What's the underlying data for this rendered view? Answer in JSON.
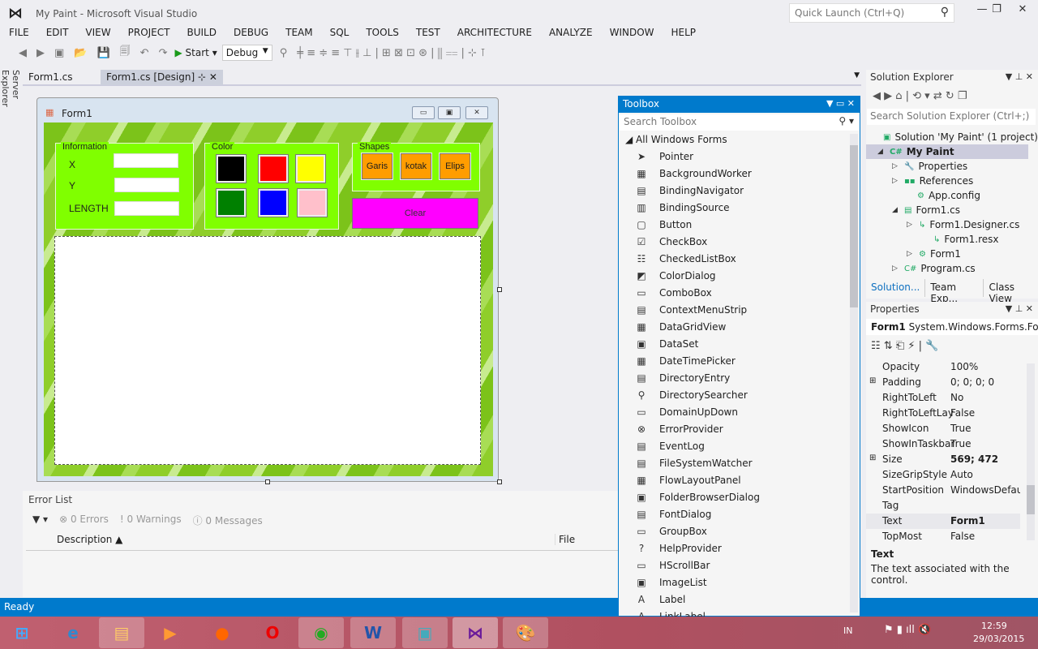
{
  "window": {
    "title": "My Paint - Microsoft Visual Studio",
    "quick_launch_placeholder": "Quick Launch (Ctrl+Q)"
  },
  "menu": [
    "FILE",
    "EDIT",
    "VIEW",
    "PROJECT",
    "BUILD",
    "DEBUG",
    "TEAM",
    "SQL",
    "TOOLS",
    "TEST",
    "ARCHITECTURE",
    "ANALYZE",
    "WINDOW",
    "HELP"
  ],
  "toolbar": {
    "start_label": "Start",
    "config_value": "Debug"
  },
  "side_tab": "Server Explorer",
  "doc_tabs": [
    {
      "label": "Form1.cs",
      "active": false
    },
    {
      "label": "Form1.cs [Design]",
      "active": true
    }
  ],
  "form": {
    "title": "Form1",
    "information": {
      "title": "Information",
      "x_label": "X",
      "y_label": "Y",
      "length_label": "LENGTH",
      "x_value": "",
      "y_value": "",
      "length_value": ""
    },
    "color": {
      "title": "Color",
      "swatches": [
        "#000000",
        "#ff0000",
        "#ffff00",
        "#008000",
        "#0000ff",
        "#ffc0cb"
      ]
    },
    "shapes": {
      "title": "Shapes",
      "buttons": [
        "Garis",
        "kotak",
        "Elips"
      ]
    },
    "clear_label": "Clear"
  },
  "error_list": {
    "title": "Error List",
    "errors": "0 Errors",
    "warnings": "0 Warnings",
    "messages": "0 Messages",
    "columns": [
      "Description",
      "File"
    ]
  },
  "status": "Ready",
  "toolbox": {
    "title": "Toolbox",
    "search_placeholder": "Search Toolbox",
    "group": "All Windows Forms",
    "items": [
      "Pointer",
      "BackgroundWorker",
      "BindingNavigator",
      "BindingSource",
      "Button",
      "CheckBox",
      "CheckedListBox",
      "ColorDialog",
      "ComboBox",
      "ContextMenuStrip",
      "DataGridView",
      "DataSet",
      "DateTimePicker",
      "DirectoryEntry",
      "DirectorySearcher",
      "DomainUpDown",
      "ErrorProvider",
      "EventLog",
      "FileSystemWatcher",
      "FlowLayoutPanel",
      "FolderBrowserDialog",
      "FontDialog",
      "GroupBox",
      "HelpProvider",
      "HScrollBar",
      "ImageList",
      "Label",
      "LinkLabel"
    ]
  },
  "solution_explorer": {
    "title": "Solution Explorer",
    "search_placeholder": "Search Solution Explorer (Ctrl+;)",
    "tree": [
      "Solution 'My Paint' (1 project)",
      "My Paint",
      "Properties",
      "References",
      "App.config",
      "Form1.cs",
      "Form1.Designer.cs",
      "Form1.resx",
      "Form1",
      "Program.cs"
    ],
    "tabs": [
      "Solution...",
      "Team Exp...",
      "Class View"
    ]
  },
  "properties": {
    "title": "Properties",
    "object": "Form1",
    "object_type": "System.Windows.Forms.Fo",
    "rows": [
      {
        "name": "Opacity",
        "value": "100%"
      },
      {
        "name": "Padding",
        "value": "0; 0; 0; 0"
      },
      {
        "name": "RightToLeft",
        "value": "No"
      },
      {
        "name": "RightToLeftLay",
        "value": "False"
      },
      {
        "name": "ShowIcon",
        "value": "True"
      },
      {
        "name": "ShowInTaskbar",
        "value": "True"
      },
      {
        "name": "Size",
        "value": "569; 472"
      },
      {
        "name": "SizeGripStyle",
        "value": "Auto"
      },
      {
        "name": "StartPosition",
        "value": "WindowsDefault"
      },
      {
        "name": "Tag",
        "value": ""
      },
      {
        "name": "Text",
        "value": "Form1"
      },
      {
        "name": "TopMost",
        "value": "False"
      }
    ],
    "desc_title": "Text",
    "desc_text": "The text associated with the control."
  },
  "tray": {
    "lang": "IN",
    "time": "12:59",
    "date": "29/03/2015"
  },
  "accent": "#007acc"
}
